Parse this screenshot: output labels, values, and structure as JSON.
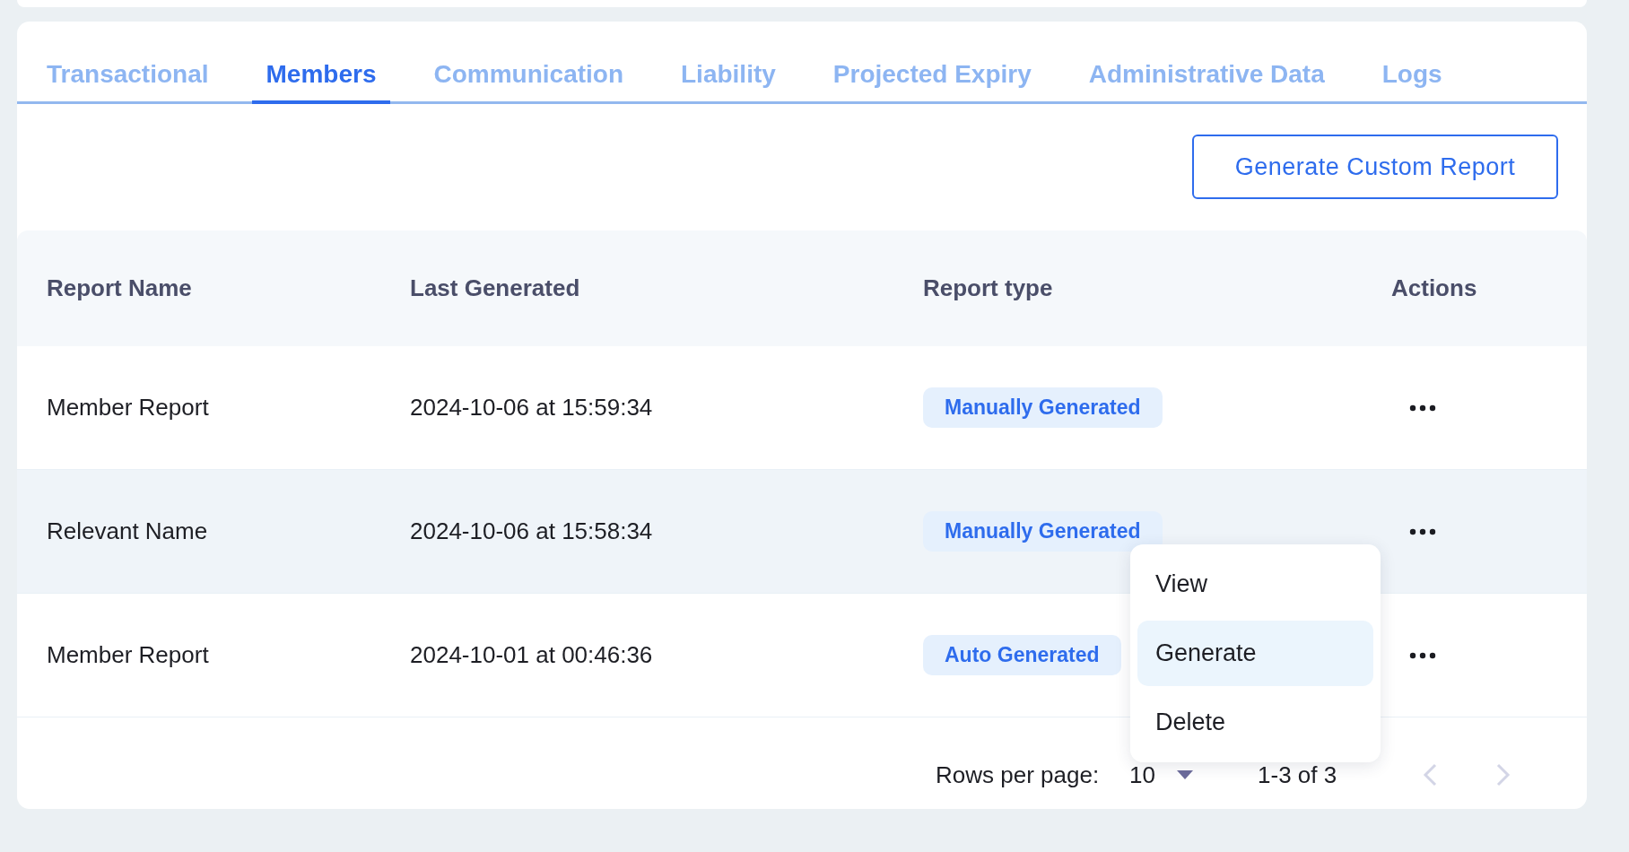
{
  "tabs": [
    {
      "label": "Transactional",
      "selected": false
    },
    {
      "label": "Members",
      "selected": true
    },
    {
      "label": "Communication",
      "selected": false
    },
    {
      "label": "Liability",
      "selected": false
    },
    {
      "label": "Projected Expiry",
      "selected": false
    },
    {
      "label": "Administrative Data",
      "selected": false
    },
    {
      "label": "Logs",
      "selected": false
    }
  ],
  "toolbar": {
    "button": "Generate Custom Report"
  },
  "table": {
    "columns": [
      "Report Name",
      "Last Generated",
      "Report type",
      "Actions"
    ],
    "rows": [
      {
        "name": "Member Report",
        "last_generated": "2024-10-06 at 15:59:34",
        "report_type": "Manually Generated",
        "highlighted": false
      },
      {
        "name": "Relevant Name",
        "last_generated": "2024-10-06 at 15:58:34",
        "report_type": "Manually Generated",
        "highlighted": true
      },
      {
        "name": "Member Report",
        "last_generated": "2024-10-01 at 00:46:36",
        "report_type": "Auto Generated",
        "highlighted": false
      }
    ]
  },
  "action_menu": {
    "items": [
      {
        "label": "View",
        "selected": false
      },
      {
        "label": "Generate",
        "selected": true
      },
      {
        "label": "Delete",
        "selected": false
      }
    ]
  },
  "pagination": {
    "rows_per_page_label": "Rows per page:",
    "rows_per_page": "10",
    "range": "1-3 of 3",
    "previous_disabled": true,
    "next_disabled": true
  }
}
